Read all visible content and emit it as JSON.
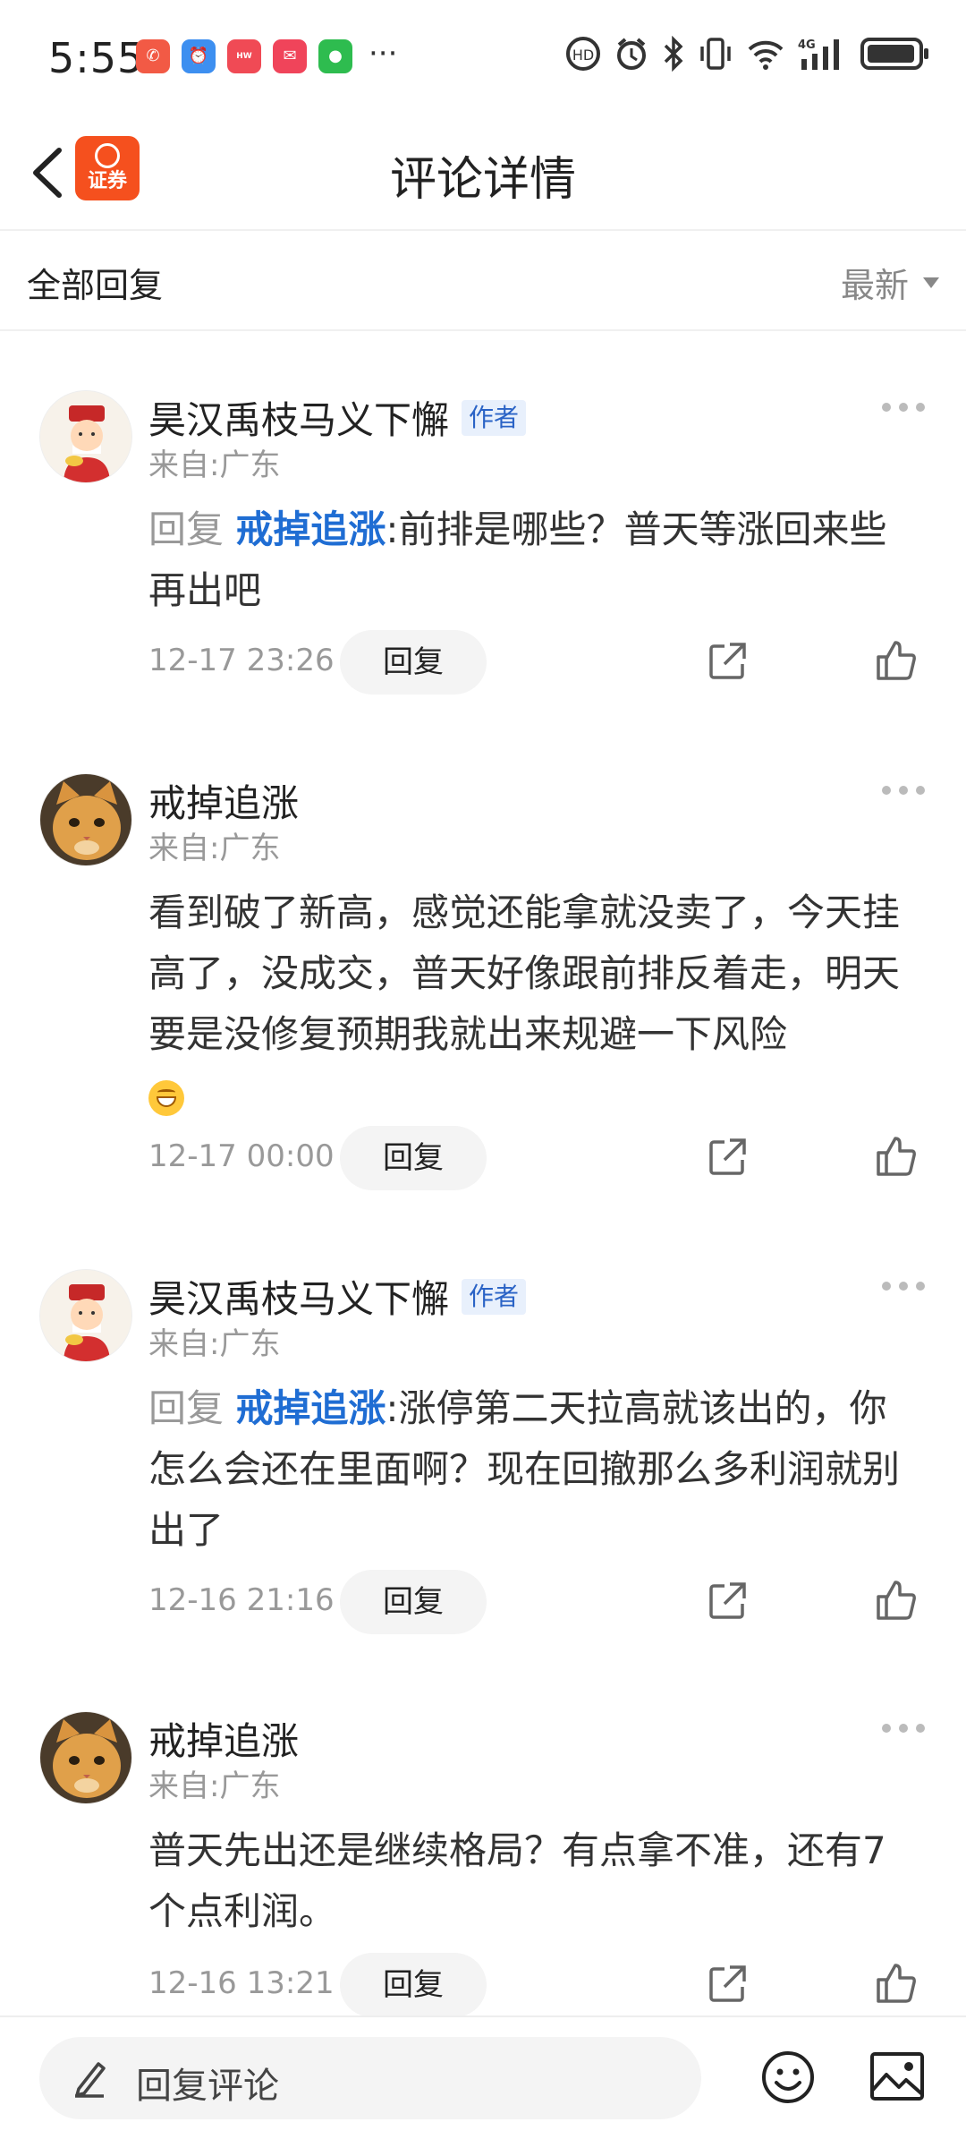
{
  "status_bar": {
    "time": "5:55",
    "more": "···",
    "notification_icons": [
      "missed-call-icon",
      "alarm-app-icon",
      "huawei-app-icon",
      "mail-app-icon",
      "wechat-icon"
    ],
    "system_icons": [
      "hd-call-icon",
      "alarm-icon",
      "bluetooth-icon",
      "vibrate-icon",
      "wifi-icon",
      "4g-signal-icon",
      "battery-icon"
    ]
  },
  "nav": {
    "title": "评论详情",
    "logo_text": "证券",
    "colors": {
      "logo": "#f5501e"
    }
  },
  "filter": {
    "label": "全部回复",
    "sort_label": "最新"
  },
  "comments": [
    {
      "user": "昊汉禹枝马义下懈",
      "is_author": true,
      "author_badge": "作者",
      "location": "来自:广东",
      "reply_prefix": "回复",
      "reply_to": "戒掉追涨",
      "separator": ":",
      "text": "前排是哪些？普天等涨回来些再出吧",
      "time": "12-17 23:26",
      "reply_label": "回复",
      "avatar": "god-of-wealth-avatar"
    },
    {
      "user": "戒掉追涨",
      "is_author": false,
      "location": "来自:广东",
      "text": "看到破了新高，感觉还能拿就没卖了，今天挂高了，没成交，普天好像跟前排反着走，明天要是没修复预期我就出来规避一下风险",
      "emoji": "grin-emoji",
      "time": "12-17 00:00",
      "reply_label": "回复",
      "avatar": "cat-avatar"
    },
    {
      "user": "昊汉禹枝马义下懈",
      "is_author": true,
      "author_badge": "作者",
      "location": "来自:广东",
      "reply_prefix": "回复",
      "reply_to": "戒掉追涨",
      "separator": ":",
      "text": "涨停第二天拉高就该出的，你怎么会还在里面啊？现在回撤那么多利润就别出了",
      "time": "12-16 21:16",
      "reply_label": "回复",
      "avatar": "god-of-wealth-avatar"
    },
    {
      "user": "戒掉追涨",
      "is_author": false,
      "location": "来自:广东",
      "text": "普天先出还是继续格局？有点拿不准，还有7个点利润。",
      "time": "12-16 13:21",
      "reply_label": "回复",
      "avatar": "cat-avatar"
    }
  ],
  "bottom_bar": {
    "placeholder": "回复评论"
  }
}
